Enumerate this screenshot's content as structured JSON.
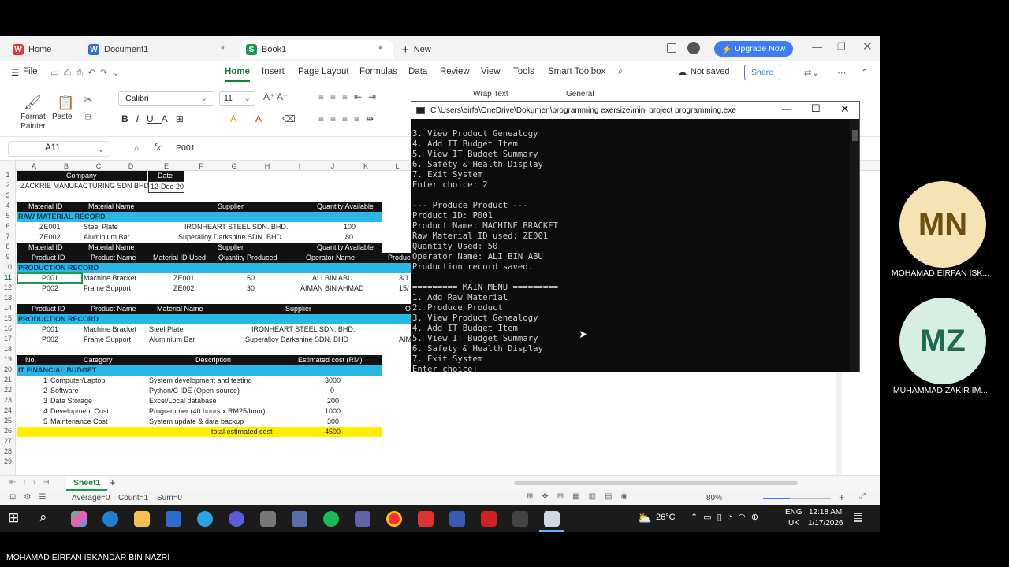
{
  "tabs": {
    "home": "Home",
    "doc": "Document1",
    "book": "Book1",
    "new": "New",
    "upgrade": "Upgrade Now"
  },
  "menu": {
    "file": "File",
    "items": [
      "Home",
      "Insert",
      "Page Layout",
      "Formulas",
      "Data",
      "Review",
      "View",
      "Tools",
      "Smart Toolbox"
    ],
    "not_saved": "Not saved",
    "share": "Share"
  },
  "ribbon": {
    "format_painter": "Format Painter",
    "paste": "Paste",
    "font": "Calibri",
    "size": "11",
    "wrap_text": "Wrap Text",
    "number_format": "General"
  },
  "formula": {
    "cell_ref": "A11",
    "fx": "fx",
    "content": "P001"
  },
  "columns": [
    "A",
    "B",
    "C",
    "D",
    "E",
    "F",
    "G",
    "H",
    "I",
    "J",
    "K",
    "L"
  ],
  "rows": [
    "1",
    "2",
    "3",
    "4",
    "5",
    "6",
    "7",
    "8",
    "9",
    "10",
    "11",
    "12",
    "13",
    "14",
    "15",
    "16",
    "17",
    "18",
    "19",
    "20",
    "21",
    "22",
    "23",
    "24",
    "25",
    "26",
    "27",
    "28",
    "29"
  ],
  "sheet": {
    "company_hdr": "Company",
    "date_hdr": "Date",
    "company": "ZACKRIE MANUFACTURING SDN BHD",
    "date": "12-Dec-20",
    "mat_hdr": [
      "Material ID",
      "Material Name",
      "Supplier",
      "Quantity Available"
    ],
    "raw_title": "RAW MATERIAL RECORD",
    "raw_rows": [
      [
        "ZE001",
        "Steel Plate",
        "IRONHEART STEEL SDN. BHD.",
        "100"
      ],
      [
        "ZE002",
        "Aluminium Bar",
        "Superalloy Darkshine SDN. BHD",
        "80"
      ]
    ],
    "prod_hdr": [
      "Product ID",
      "Product Name",
      "Material ID Used",
      "Quantity Produced",
      "Operator Name",
      "Produc"
    ],
    "prod_title": "PRODUCTION RECORD",
    "prod_rows": [
      [
        "P001",
        "Machine Bracket",
        "ZE001",
        "50",
        "ALI BIN ABU",
        "3/1"
      ],
      [
        "P002",
        "Frame Support",
        "ZE002",
        "30",
        "AIMAN BIN AHMAD",
        "15/"
      ]
    ],
    "gen_hdr": [
      "Product ID",
      "Product Name",
      "Material Name",
      "Supplier",
      "O"
    ],
    "gen_title": "PRODUCTION RECORD",
    "gen_rows": [
      [
        "P001",
        "Machine Bracket",
        "Steel Plate",
        "IRONHEART STEEL SDN. BHD.",
        ""
      ],
      [
        "P002",
        "Frame Support",
        "Aluminium Bar",
        "Superalloy Darkshine SDN. BHD",
        "AIM"
      ]
    ],
    "bud_hdr": [
      "No.",
      "Category",
      "Description",
      "Estimated cost (RM)"
    ],
    "bud_title": "IT FINANCIAL BUDGET",
    "bud_rows": [
      [
        "1",
        "Computer/Laptop",
        "System development and testing",
        "3000"
      ],
      [
        "2",
        "Software",
        "Python/C IDE (Open-source)",
        "0"
      ],
      [
        "3",
        "Data Storage",
        "Excel/Local database",
        "200"
      ],
      [
        "4",
        "Development Cost",
        "Programmer (40 hours x RM25/hour)",
        "1000"
      ],
      [
        "5",
        "Maintenance Cost",
        "System update & data backup",
        "300"
      ]
    ],
    "total_label": "total estimated cost",
    "total": "4500"
  },
  "sheetbar": {
    "sheet": "Sheet1",
    "add": "+"
  },
  "statusbar": {
    "average": "Average=0",
    "count": "Count=1",
    "sum": "Sum=0",
    "zoom": "80%"
  },
  "console": {
    "title": "C:\\Users\\eirfa\\OneDrive\\Dokumen\\programming exersize\\mini project programming.exe",
    "lines": [
      "3. View Product Genealogy",
      "4. Add IT Budget Item",
      "5. View IT Budget Summary",
      "6. Safety & Health Display",
      "7. Exit System",
      "Enter choice: 2",
      "",
      "--- Produce Product ---",
      "Product ID: P001",
      "Product Name: MACHINE BRACKET",
      "Raw Material ID used: ZE001",
      "Quantity Used: 50",
      "Operator Name: ALI BIN ABU",
      "Production record saved.",
      "",
      "========= MAIN MENU =========",
      "1. Add Raw Material",
      "2. Produce Product",
      "3. View Product Genealogy",
      "4. Add IT Budget Item",
      "5. View IT Budget Summary",
      "6. Safety & Health Display",
      "7. Exit System",
      "Enter choice: _"
    ]
  },
  "participants": [
    {
      "initials": "MN",
      "name": "MOHAMAD EIRFAN ISK...",
      "bg": "#f6e3b4",
      "fg": "#6b4e12"
    },
    {
      "initials": "MZ",
      "name": "MUHAMMAD ZAKIR IM...",
      "bg": "#d7efe3",
      "fg": "#1d6b50"
    }
  ],
  "taskbar": {
    "temp": "26°C",
    "lang1": "ENG",
    "lang2": "UK",
    "time": "12:18 AM",
    "date": "1/17/2026"
  },
  "speaker": "MOHAMAD EIRFAN ISKANDAR BIN NAZRI"
}
